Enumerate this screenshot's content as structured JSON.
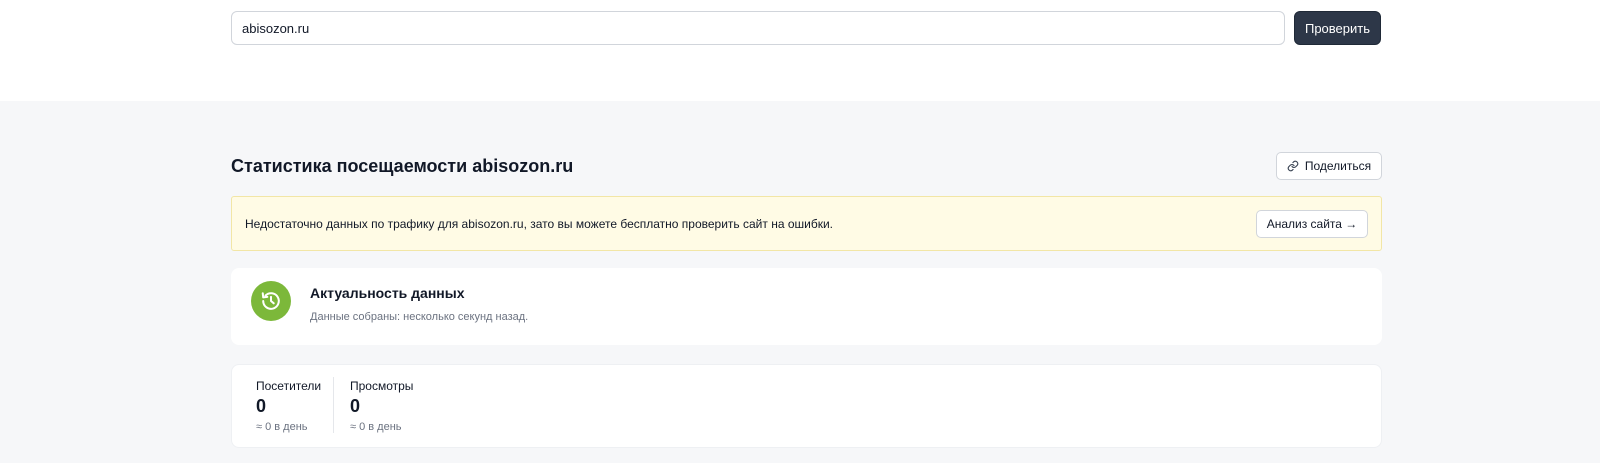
{
  "search": {
    "value": "abisozon.ru",
    "button_label": "Проверить"
  },
  "header": {
    "title": "Статистика посещаемости abisozon.ru",
    "share_label": "Поделиться",
    "share_icon": "link-icon"
  },
  "notice": {
    "text": "Недостаточно данных по трафику для abisozon.ru, зато вы можете бесплатно проверить сайт на ошибки.",
    "button_label": "Анализ сайта →",
    "background": "#fffbe5"
  },
  "freshness": {
    "icon": "clock-history-icon",
    "icon_color": "#7cb83a",
    "title": "Актуальность данных",
    "subtitle": "Данные собраны: несколько секунд назад."
  },
  "stats": [
    {
      "label": "Посетители",
      "value": "0",
      "per_day": "≈ 0 в день"
    },
    {
      "label": "Просмотры",
      "value": "0",
      "per_day": "≈ 0 в день"
    }
  ],
  "colors": {
    "primary_button": "#2d3748",
    "page_background": "#f6f7f9"
  }
}
